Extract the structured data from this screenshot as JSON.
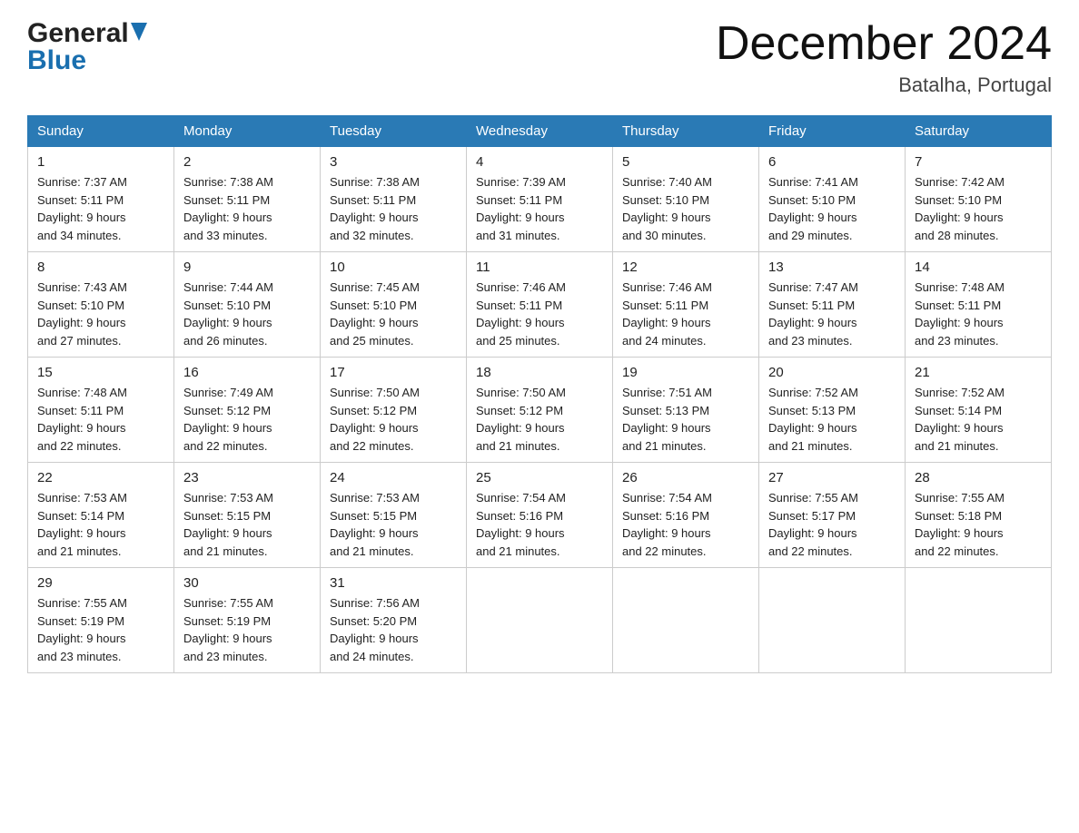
{
  "header": {
    "logo_general": "General",
    "logo_blue": "Blue",
    "month_title": "December 2024",
    "location": "Batalha, Portugal"
  },
  "days_of_week": [
    "Sunday",
    "Monday",
    "Tuesday",
    "Wednesday",
    "Thursday",
    "Friday",
    "Saturday"
  ],
  "weeks": [
    [
      {
        "day": "1",
        "sunrise": "7:37 AM",
        "sunset": "5:11 PM",
        "daylight": "9 hours and 34 minutes."
      },
      {
        "day": "2",
        "sunrise": "7:38 AM",
        "sunset": "5:11 PM",
        "daylight": "9 hours and 33 minutes."
      },
      {
        "day": "3",
        "sunrise": "7:38 AM",
        "sunset": "5:11 PM",
        "daylight": "9 hours and 32 minutes."
      },
      {
        "day": "4",
        "sunrise": "7:39 AM",
        "sunset": "5:11 PM",
        "daylight": "9 hours and 31 minutes."
      },
      {
        "day": "5",
        "sunrise": "7:40 AM",
        "sunset": "5:10 PM",
        "daylight": "9 hours and 30 minutes."
      },
      {
        "day": "6",
        "sunrise": "7:41 AM",
        "sunset": "5:10 PM",
        "daylight": "9 hours and 29 minutes."
      },
      {
        "day": "7",
        "sunrise": "7:42 AM",
        "sunset": "5:10 PM",
        "daylight": "9 hours and 28 minutes."
      }
    ],
    [
      {
        "day": "8",
        "sunrise": "7:43 AM",
        "sunset": "5:10 PM",
        "daylight": "9 hours and 27 minutes."
      },
      {
        "day": "9",
        "sunrise": "7:44 AM",
        "sunset": "5:10 PM",
        "daylight": "9 hours and 26 minutes."
      },
      {
        "day": "10",
        "sunrise": "7:45 AM",
        "sunset": "5:10 PM",
        "daylight": "9 hours and 25 minutes."
      },
      {
        "day": "11",
        "sunrise": "7:46 AM",
        "sunset": "5:11 PM",
        "daylight": "9 hours and 25 minutes."
      },
      {
        "day": "12",
        "sunrise": "7:46 AM",
        "sunset": "5:11 PM",
        "daylight": "9 hours and 24 minutes."
      },
      {
        "day": "13",
        "sunrise": "7:47 AM",
        "sunset": "5:11 PM",
        "daylight": "9 hours and 23 minutes."
      },
      {
        "day": "14",
        "sunrise": "7:48 AM",
        "sunset": "5:11 PM",
        "daylight": "9 hours and 23 minutes."
      }
    ],
    [
      {
        "day": "15",
        "sunrise": "7:48 AM",
        "sunset": "5:11 PM",
        "daylight": "9 hours and 22 minutes."
      },
      {
        "day": "16",
        "sunrise": "7:49 AM",
        "sunset": "5:12 PM",
        "daylight": "9 hours and 22 minutes."
      },
      {
        "day": "17",
        "sunrise": "7:50 AM",
        "sunset": "5:12 PM",
        "daylight": "9 hours and 22 minutes."
      },
      {
        "day": "18",
        "sunrise": "7:50 AM",
        "sunset": "5:12 PM",
        "daylight": "9 hours and 21 minutes."
      },
      {
        "day": "19",
        "sunrise": "7:51 AM",
        "sunset": "5:13 PM",
        "daylight": "9 hours and 21 minutes."
      },
      {
        "day": "20",
        "sunrise": "7:52 AM",
        "sunset": "5:13 PM",
        "daylight": "9 hours and 21 minutes."
      },
      {
        "day": "21",
        "sunrise": "7:52 AM",
        "sunset": "5:14 PM",
        "daylight": "9 hours and 21 minutes."
      }
    ],
    [
      {
        "day": "22",
        "sunrise": "7:53 AM",
        "sunset": "5:14 PM",
        "daylight": "9 hours and 21 minutes."
      },
      {
        "day": "23",
        "sunrise": "7:53 AM",
        "sunset": "5:15 PM",
        "daylight": "9 hours and 21 minutes."
      },
      {
        "day": "24",
        "sunrise": "7:53 AM",
        "sunset": "5:15 PM",
        "daylight": "9 hours and 21 minutes."
      },
      {
        "day": "25",
        "sunrise": "7:54 AM",
        "sunset": "5:16 PM",
        "daylight": "9 hours and 21 minutes."
      },
      {
        "day": "26",
        "sunrise": "7:54 AM",
        "sunset": "5:16 PM",
        "daylight": "9 hours and 22 minutes."
      },
      {
        "day": "27",
        "sunrise": "7:55 AM",
        "sunset": "5:17 PM",
        "daylight": "9 hours and 22 minutes."
      },
      {
        "day": "28",
        "sunrise": "7:55 AM",
        "sunset": "5:18 PM",
        "daylight": "9 hours and 22 minutes."
      }
    ],
    [
      {
        "day": "29",
        "sunrise": "7:55 AM",
        "sunset": "5:19 PM",
        "daylight": "9 hours and 23 minutes."
      },
      {
        "day": "30",
        "sunrise": "7:55 AM",
        "sunset": "5:19 PM",
        "daylight": "9 hours and 23 minutes."
      },
      {
        "day": "31",
        "sunrise": "7:56 AM",
        "sunset": "5:20 PM",
        "daylight": "9 hours and 24 minutes."
      },
      null,
      null,
      null,
      null
    ]
  ],
  "labels": {
    "sunrise": "Sunrise:",
    "sunset": "Sunset:",
    "daylight": "Daylight:"
  }
}
